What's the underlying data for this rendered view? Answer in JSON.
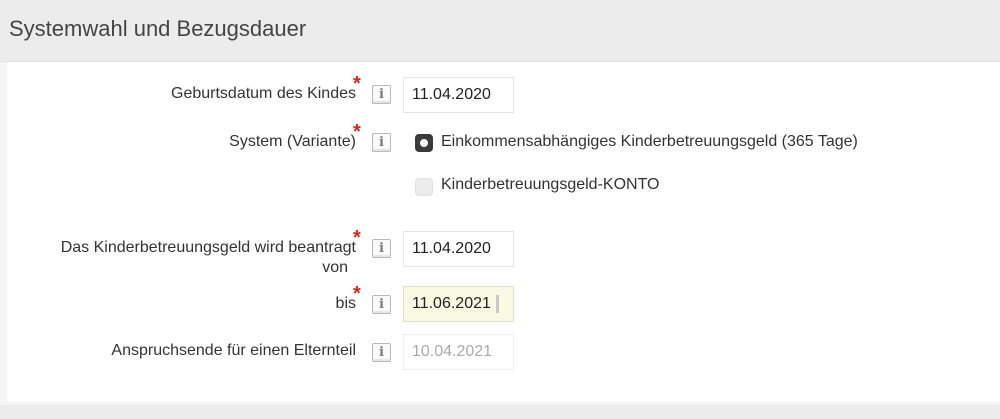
{
  "section": {
    "title": "Systemwahl und Bezugsdauer"
  },
  "fields": {
    "birthdate": {
      "label": "Geburtsdatum des Kindes",
      "value": "11.04.2020",
      "required": "*"
    },
    "system": {
      "label": "System (Variante)",
      "required": "*",
      "options": [
        {
          "label": "Einkommensabhängiges Kinderbetreuungsgeld (365 Tage)",
          "selected": true
        },
        {
          "label": "Kinderbetreuungsgeld-KONTO",
          "selected": false
        }
      ]
    },
    "from": {
      "label_line1": "Das Kinderbetreuungsgeld wird beantragt",
      "label_line2": "von",
      "value": "11.04.2020",
      "required": "*"
    },
    "to": {
      "label": "bis",
      "value": "11.06.2021",
      "required": "*"
    },
    "claim_end": {
      "label": "Anspruchsende für einen Elternteil",
      "value": "10.04.2021"
    }
  },
  "icons": {
    "info": "i"
  }
}
